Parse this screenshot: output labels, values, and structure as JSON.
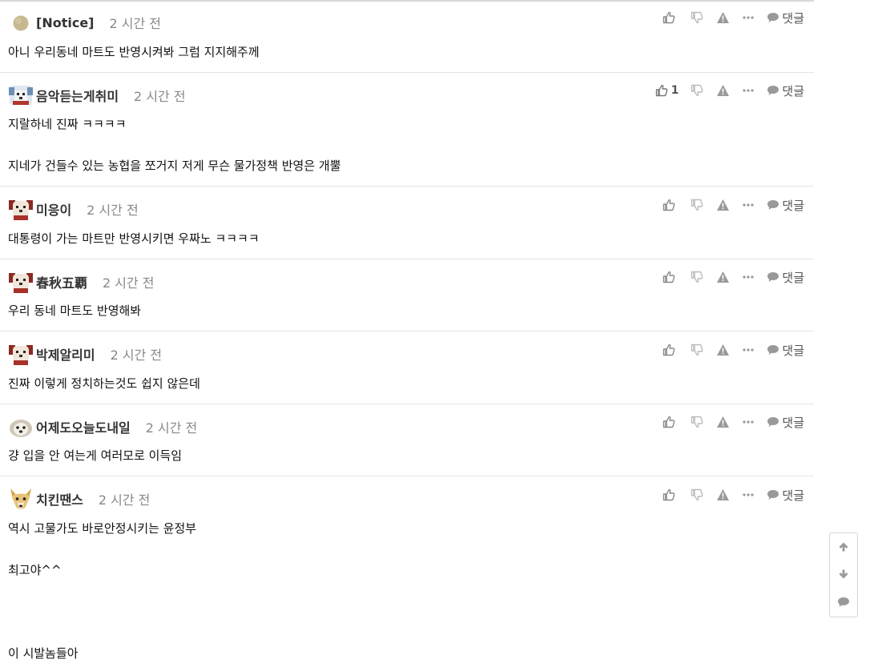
{
  "comments": [
    {
      "nickname": "[Notice]",
      "time": "2 시간 전",
      "avatar": "notice-avatar",
      "like_count": "",
      "reply_label": "댓글",
      "lines": [
        "아니 우리동네 마트도 반영시켜봐 그럼 지지해주께"
      ]
    },
    {
      "nickname": "음악듣는게취미",
      "time": "2 시간 전",
      "avatar": "pixel-dog-avatar",
      "like_count": "1",
      "reply_label": "댓글",
      "lines": [
        "지랄하네 진짜 ㅋㅋㅋㅋ",
        "",
        "지네가 건들수 있는 농협을 쪼거지 저게 무슨 물가정책 반영은 개뿔"
      ]
    },
    {
      "nickname": "미응이",
      "time": "2 시간 전",
      "avatar": "pixel-dog-avatar",
      "like_count": "",
      "reply_label": "댓글",
      "lines": [
        "대통령이 가는 마트만 반영시키면 우짜노 ㅋㅋㅋㅋ"
      ]
    },
    {
      "nickname": "春秋五覇",
      "time": "2 시간 전",
      "avatar": "pixel-dog-avatar",
      "like_count": "",
      "reply_label": "댓글",
      "lines": [
        "우리 동네 마트도 반영해봐"
      ]
    },
    {
      "nickname": "박제알리미",
      "time": "2 시간 전",
      "avatar": "pixel-dog-avatar",
      "like_count": "",
      "reply_label": "댓글",
      "lines": [
        "진짜 이렇게 정치하는것도 쉽지 않은데"
      ]
    },
    {
      "nickname": "어제도오늘도내일",
      "time": "2 시간 전",
      "avatar": "puppy-avatar",
      "like_count": "",
      "reply_label": "댓글",
      "lines": [
        "걍 입을 안 여는게 여러모로 이득임"
      ]
    },
    {
      "nickname": "치킨땐스",
      "time": "2 시간 전",
      "avatar": "fox-avatar",
      "like_count": "",
      "reply_label": "댓글",
      "lines": [
        "역시 고물가도 바로안정시키는 윤정부",
        "",
        "최고야^^",
        "",
        "",
        "",
        "이 시발놈들아"
      ]
    }
  ],
  "icons": {
    "like": "thumbs-up-icon",
    "dislike": "thumbs-down-icon",
    "report": "warning-icon",
    "more": "ellipsis-icon",
    "reply": "speech-bubble-icon"
  },
  "scroll_panel": {
    "up": "arrow-up-icon",
    "down": "arrow-down-icon",
    "comments": "comment-icon"
  },
  "colors": {
    "icon": "#888888",
    "nickname": "#333333",
    "time": "#888888",
    "divider": "#e5e5e5"
  }
}
